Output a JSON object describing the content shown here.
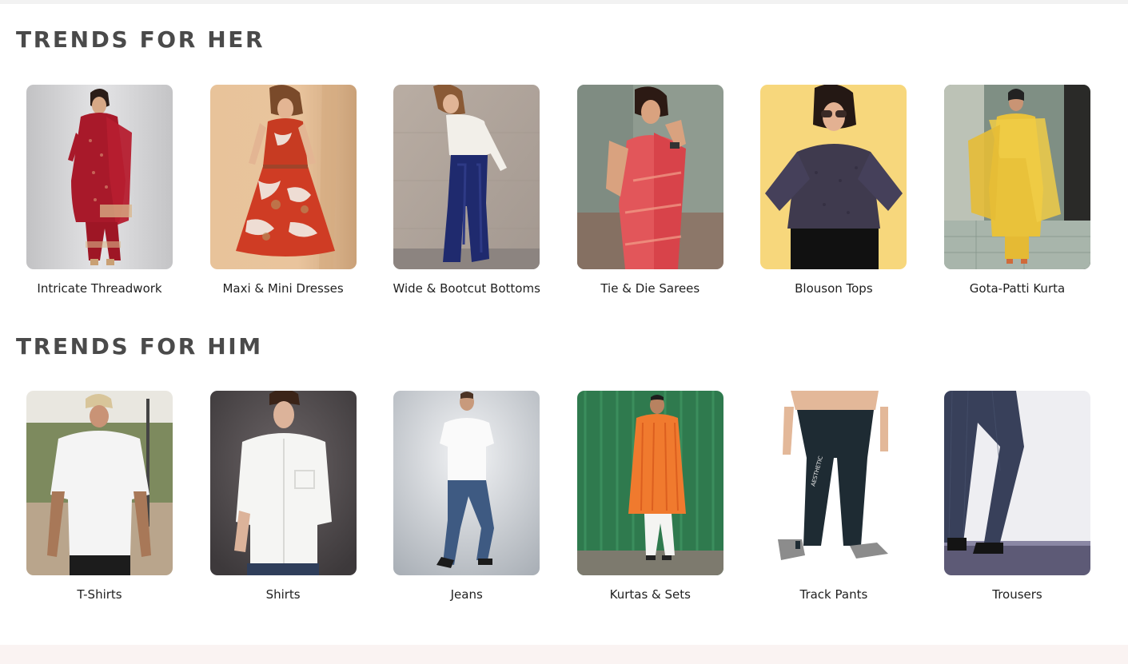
{
  "sections": [
    {
      "title": "TRENDS FOR HER",
      "items": [
        {
          "label": "Intricate Threadwork",
          "icon": "woman-red-kurta-photo"
        },
        {
          "label": "Maxi & Mini Dresses",
          "icon": "woman-printed-dress-photo"
        },
        {
          "label": "Wide & Bootcut Bottoms",
          "icon": "woman-velvet-bootcut-photo"
        },
        {
          "label": "Tie & Die Sarees",
          "icon": "woman-red-saree-photo"
        },
        {
          "label": "Blouson Tops",
          "icon": "woman-blouson-top-photo"
        },
        {
          "label": "Gota-Patti Kurta",
          "icon": "woman-yellow-kurta-photo"
        }
      ]
    },
    {
      "title": "TRENDS FOR HIM",
      "items": [
        {
          "label": "T-Shirts",
          "icon": "man-white-tshirt-photo"
        },
        {
          "label": "Shirts",
          "icon": "man-white-shirt-photo"
        },
        {
          "label": "Jeans",
          "icon": "man-blue-jeans-photo"
        },
        {
          "label": "Kurtas & Sets",
          "icon": "man-orange-kurta-photo"
        },
        {
          "label": "Track Pants",
          "icon": "man-track-pants-photo",
          "print": "AESTHETIC"
        },
        {
          "label": "Trousers",
          "icon": "man-trousers-photo"
        }
      ]
    }
  ],
  "colors": {
    "heading": "#4a4a4a",
    "caption": "#1f1f1f",
    "top_strip": "#f2f2f2",
    "footer_strip": "#faf3f2"
  }
}
